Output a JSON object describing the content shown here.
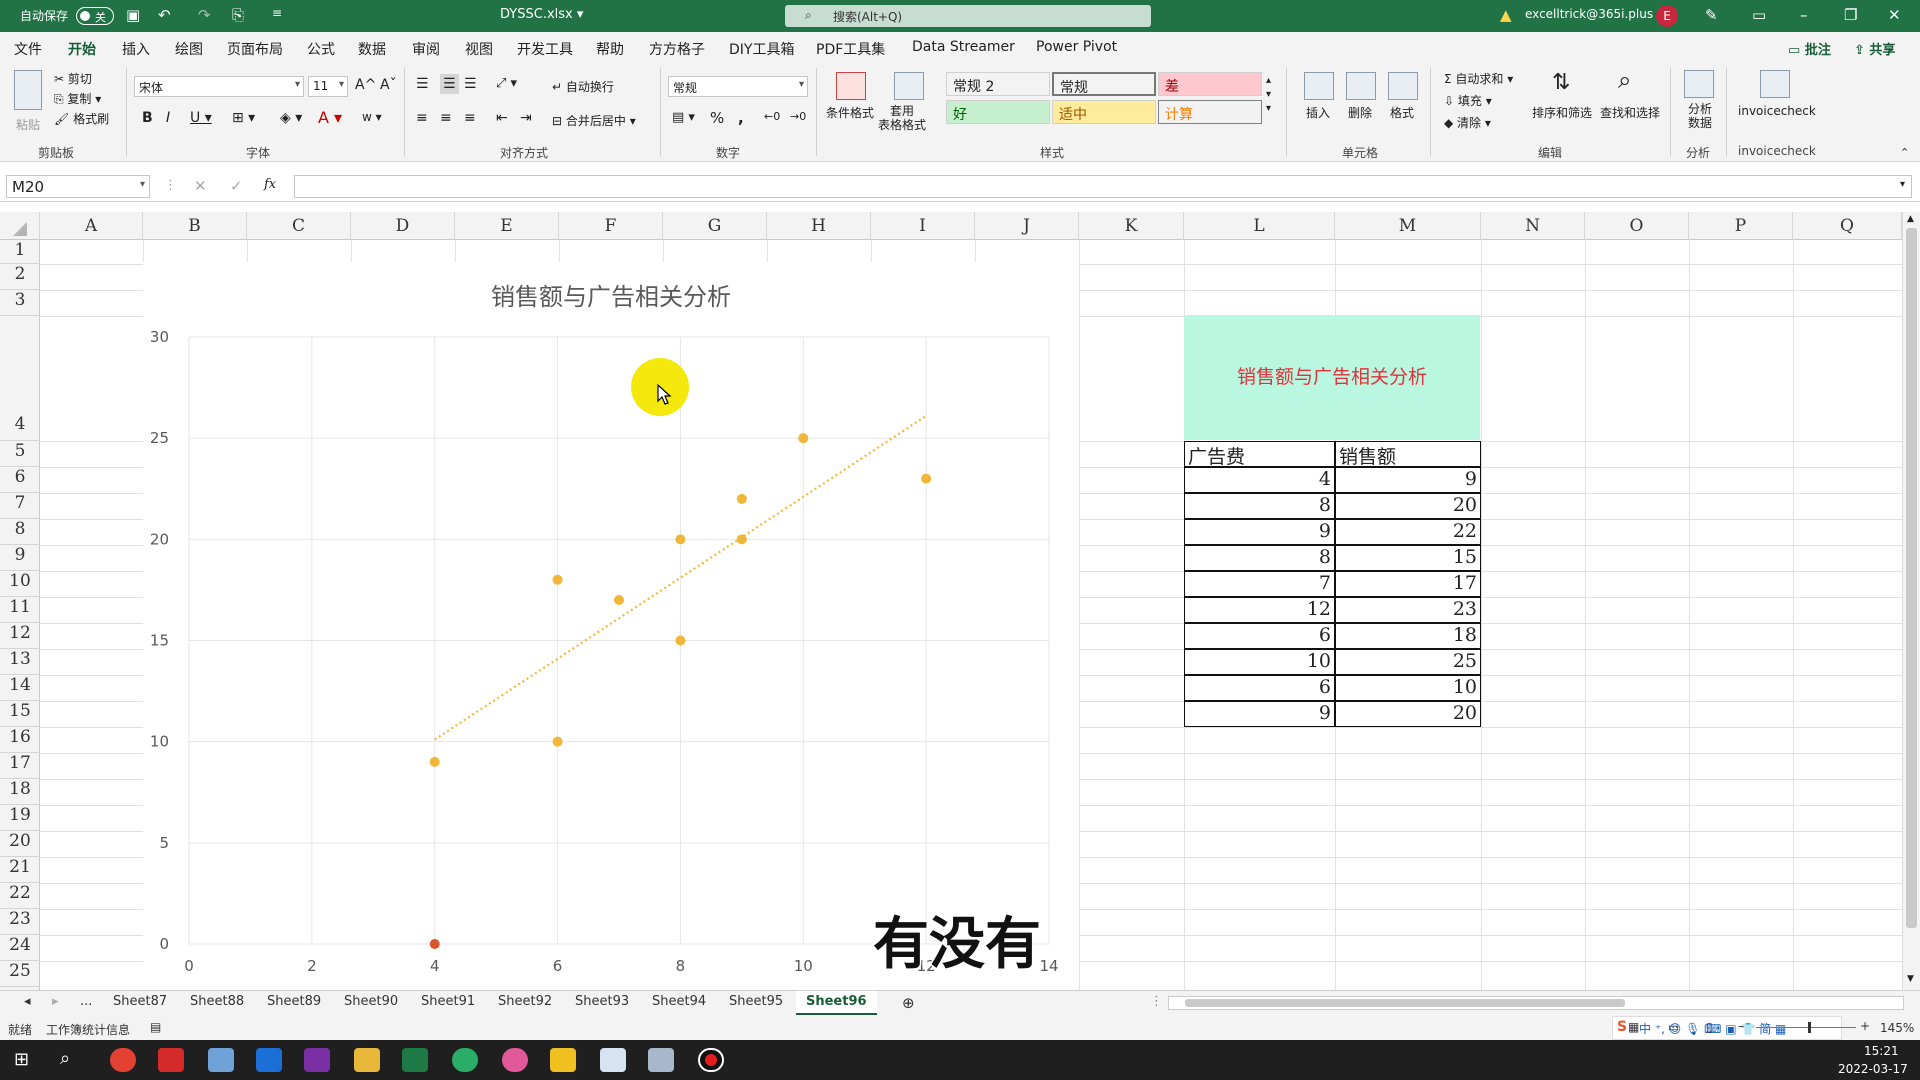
{
  "titlebar": {
    "autosave_label": "自动保存",
    "autosave_state": "关",
    "filename": "DYSSC.xlsx",
    "search_placeholder": "搜索(Alt+Q)",
    "account": "excelltrick@365i.plus",
    "avatar_letter": "E"
  },
  "tabs": [
    "文件",
    "开始",
    "插入",
    "绘图",
    "页面布局",
    "公式",
    "数据",
    "审阅",
    "视图",
    "开发工具",
    "帮助",
    "方方格子",
    "DIY工具箱",
    "PDF工具集",
    "Data Streamer",
    "Power Pivot"
  ],
  "active_tab": "开始",
  "tab_right": {
    "comments": "批注",
    "share": "共享"
  },
  "ribbon": {
    "clipboard": {
      "paste": "粘贴",
      "cut": "剪切",
      "copy": "复制",
      "format_painter": "格式刷",
      "label": "剪贴板"
    },
    "font": {
      "name": "宋体",
      "size": "11",
      "label": "字体"
    },
    "alignment": {
      "wrap": "自动换行",
      "merge": "合并后居中",
      "label": "对齐方式"
    },
    "number": {
      "format": "常规",
      "label": "数字"
    },
    "styles": {
      "cond_format": "条件格式",
      "table_format": "套用\n表格格式",
      "cells": [
        {
          "text": "常规 2",
          "bg": "#ffffff",
          "fg": "#000000"
        },
        {
          "text": "常规",
          "bg": "#ffffff",
          "fg": "#000000"
        },
        {
          "text": "差",
          "bg": "#ffc7ce",
          "fg": "#9c0006"
        },
        {
          "text": "好",
          "bg": "#c6efce",
          "fg": "#006100"
        },
        {
          "text": "适中",
          "bg": "#ffeb9c",
          "fg": "#9c5700"
        },
        {
          "text": "计算",
          "bg": "#f2f2f2",
          "fg": "#fa7d00"
        }
      ],
      "label": "样式"
    },
    "cells": {
      "insert": "插入",
      "delete": "删除",
      "format": "格式",
      "label": "单元格"
    },
    "editing": {
      "autosum": "自动求和",
      "fill": "填充",
      "clear": "清除",
      "sort": "排序和筛选",
      "find": "查找和选择",
      "label": "编辑"
    },
    "analysis": {
      "analyze": "分析\n数据",
      "label": "分析"
    },
    "invoice": {
      "name": "invoicecheck",
      "label": "invoicecheck"
    }
  },
  "formula_bar": {
    "name_box": "M20",
    "fx": "fx",
    "content": ""
  },
  "columns": [
    "A",
    "B",
    "C",
    "D",
    "E",
    "F",
    "G",
    "H",
    "I",
    "J",
    "K",
    "L",
    "M",
    "N",
    "O",
    "P",
    "Q"
  ],
  "rows": [
    "1",
    "2",
    "3",
    "4",
    "5",
    "6",
    "7",
    "8",
    "9",
    "10",
    "11",
    "12",
    "13",
    "14",
    "15",
    "16",
    "17",
    "18",
    "19",
    "20",
    "21",
    "22",
    "23",
    "24",
    "25"
  ],
  "chart_data": {
    "type": "scatter",
    "title": "销售额与广告相关分析",
    "xlim": [
      0,
      14
    ],
    "ylim": [
      0,
      30
    ],
    "xticks": [
      "0",
      "2",
      "4",
      "6",
      "8",
      "10",
      "12",
      "14"
    ],
    "yticks": [
      "0",
      "5",
      "10",
      "15",
      "20",
      "25",
      "30"
    ],
    "series": [
      {
        "color": "#f0b73a",
        "points": [
          [
            4,
            9
          ],
          [
            8,
            20
          ],
          [
            9,
            22
          ],
          [
            8,
            15
          ],
          [
            7,
            17
          ],
          [
            12,
            23
          ],
          [
            6,
            18
          ],
          [
            10,
            25
          ],
          [
            6,
            10
          ],
          [
            9,
            20
          ]
        ]
      }
    ],
    "extra_point": {
      "x": 4,
      "y": 0,
      "color": "#d9552b"
    },
    "trendline": {
      "x1": 4,
      "y1": 10.1,
      "x2": 12,
      "y2": 26.1,
      "color": "#f0b73a"
    },
    "grid": true
  },
  "data_table": {
    "title": "销售额与广告相关分析",
    "headers": [
      "广告费",
      "销售额"
    ],
    "rows": [
      [
        "4",
        "9"
      ],
      [
        "8",
        "20"
      ],
      [
        "9",
        "22"
      ],
      [
        "8",
        "15"
      ],
      [
        "7",
        "17"
      ],
      [
        "12",
        "23"
      ],
      [
        "6",
        "18"
      ],
      [
        "10",
        "25"
      ],
      [
        "6",
        "10"
      ],
      [
        "9",
        "20"
      ]
    ]
  },
  "sheets": [
    "Sheet87",
    "Sheet88",
    "Sheet89",
    "Sheet90",
    "Sheet91",
    "Sheet92",
    "Sheet93",
    "Sheet94",
    "Sheet95",
    "Sheet96"
  ],
  "active_sheet": "Sheet96",
  "sheet_ellipsis": "...",
  "status": {
    "ready": "就绪",
    "stats": "工作簿统计信息",
    "zoom": "145%"
  },
  "subtitle": "有没有",
  "taskbar": {
    "time": "15:21",
    "date": "2022-03-17"
  }
}
